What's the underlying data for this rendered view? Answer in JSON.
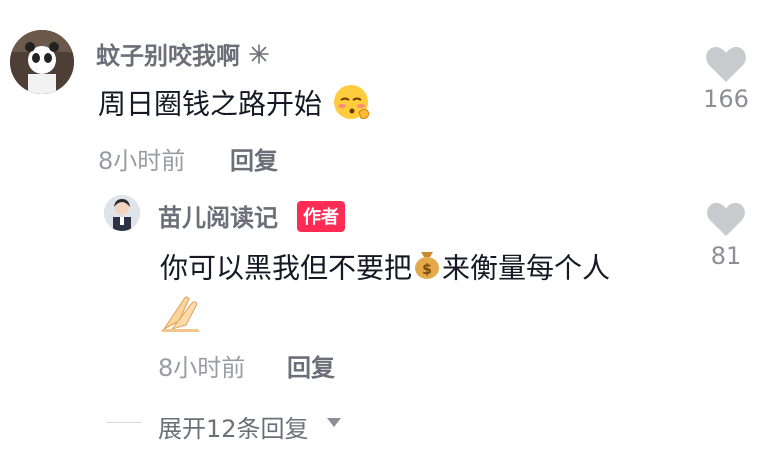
{
  "comments": [
    {
      "username": "蚊子别咬我啊",
      "text": "周日圈钱之路开始",
      "time": "8小时前",
      "reply_label": "回复",
      "likes": "166"
    }
  ],
  "reply": {
    "username": "苗儿阅读记",
    "badge": "作者",
    "text_part1": "你可以黑我但不要把",
    "text_part2": "来衡量每个人",
    "time": "8小时前",
    "reply_label": "回复",
    "likes": "81"
  },
  "expand_label": "展开12条回复",
  "colors": {
    "username": "#6d6f78",
    "badge_bg": "#fe2c55",
    "like_icon": "#c9cacd",
    "muted": "#9b9ca3"
  },
  "icons": [
    "sparkle-icon",
    "heart-icon",
    "money-bag-icon",
    "blush-emoji-icon",
    "praying-hands-icon",
    "chevron-down-icon"
  ]
}
